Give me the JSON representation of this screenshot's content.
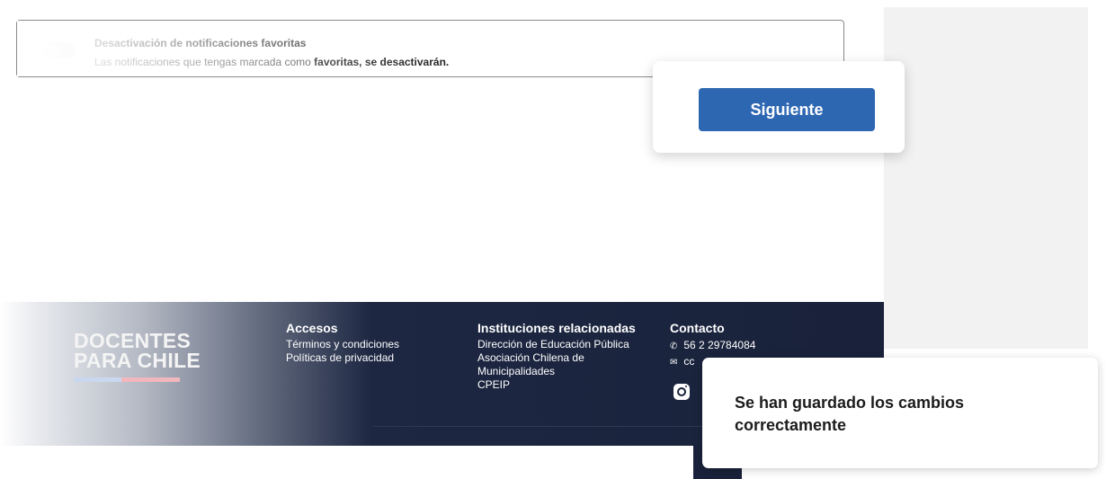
{
  "notification": {
    "title": "Desactivación de notificaciones favoritas",
    "desc_prefix": "Las notificaciones que tengas marcada como ",
    "desc_bold": "favoritas, se desactivarán."
  },
  "actions": {
    "next_label": "Siguiente"
  },
  "footer": {
    "brand_line1": "DOCENTES",
    "brand_line2": "PARA CHILE",
    "accesos": {
      "title": "Accesos",
      "items": [
        "Términos y condiciones",
        "Políticas de privacidad"
      ]
    },
    "instituciones": {
      "title": "Instituciones relacionadas",
      "items": [
        "Dirección de Educación Pública",
        "Asociación Chilena de Municipalidades",
        "CPEIP"
      ]
    },
    "contacto": {
      "title": "Contacto",
      "phone": "56 2 29784084",
      "email": "cc"
    }
  },
  "toast": {
    "message": "Se han guardado los cambios correctamente"
  },
  "colors": {
    "primary": "#2d67b2",
    "footer_bg": "#19223a"
  }
}
